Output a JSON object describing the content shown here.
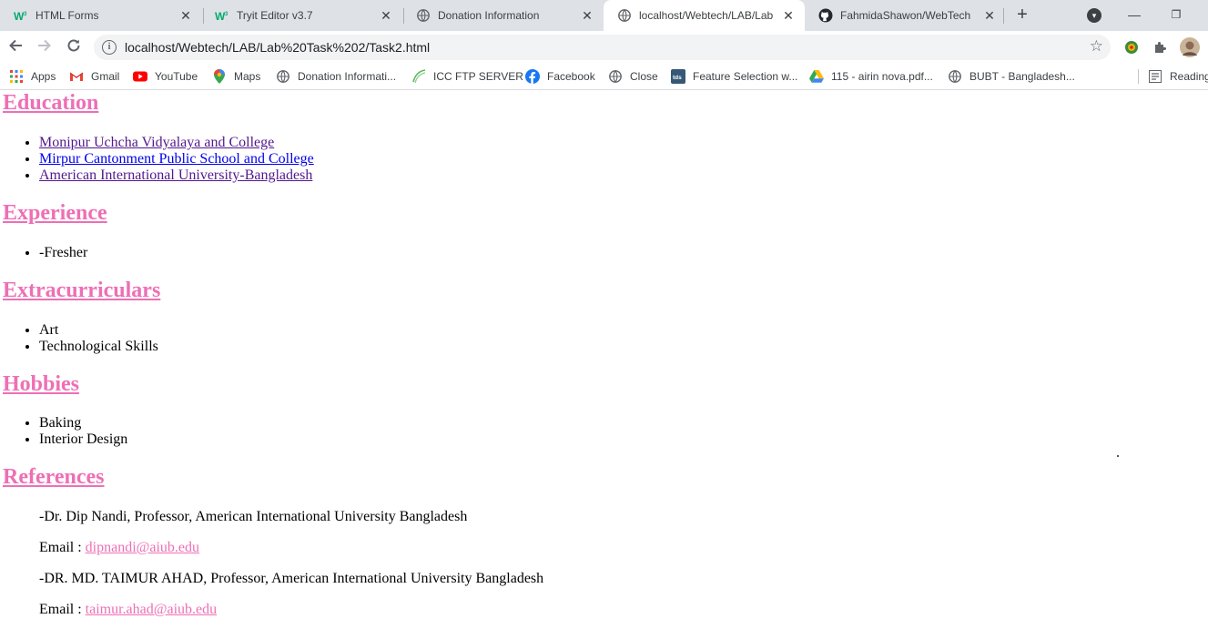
{
  "tabs": [
    {
      "title": "HTML Forms",
      "icon": "w3schools-icon",
      "active": false
    },
    {
      "title": "Tryit Editor v3.7",
      "icon": "w3schools-icon",
      "active": false
    },
    {
      "title": "Donation Information",
      "icon": "globe-icon",
      "active": false
    },
    {
      "title": "localhost/Webtech/LAB/Lab",
      "icon": "globe-icon",
      "active": true
    },
    {
      "title": "FahmidaShawon/WebTech",
      "icon": "github-icon",
      "active": false
    }
  ],
  "address_bar": {
    "url": "localhost/Webtech/LAB/Lab%20Task%202/Task2.html"
  },
  "bookmarks": [
    {
      "label": "Apps",
      "icon": "apps-grid-icon"
    },
    {
      "label": "Gmail",
      "icon": "gmail-icon"
    },
    {
      "label": "YouTube",
      "icon": "youtube-icon"
    },
    {
      "label": "Maps",
      "icon": "maps-pin-icon"
    },
    {
      "label": "Donation Informati...",
      "icon": "globe-icon"
    },
    {
      "label": "ICC FTP SERVER",
      "icon": "icc-icon"
    },
    {
      "label": "Facebook",
      "icon": "facebook-icon"
    },
    {
      "label": "Close",
      "icon": "globe-icon"
    },
    {
      "label": "Feature Selection w...",
      "icon": "tds-icon"
    },
    {
      "label": "115 - airin nova.pdf...",
      "icon": "google-drive-icon"
    },
    {
      "label": "BUBT - Bangladesh...",
      "icon": "globe-icon"
    }
  ],
  "reading_list": "Reading",
  "colors": {
    "heading": "#ee6fb5",
    "visited_link": "#52188c",
    "link": "#0000ee"
  },
  "page": {
    "education": {
      "heading": "Education",
      "items": [
        "Monipur Uchcha Vidyalaya and College",
        "Mirpur Cantonment Public School and College",
        "American International University-Bangladesh"
      ]
    },
    "experience": {
      "heading": "Experience",
      "items": [
        "-Fresher"
      ]
    },
    "extracurriculars": {
      "heading": "Extracurriculars",
      "items": [
        "Art",
        "Technological Skills"
      ]
    },
    "hobbies": {
      "heading": "Hobbies",
      "items": [
        "Baking",
        "Interior Design"
      ]
    },
    "references": {
      "heading": "References",
      "ref1_name": "-Dr. Dip Nandi, Professor, American International University Bangladesh",
      "ref1_email_label": "Email : ",
      "ref1_email": "dipnandi@aiub.edu",
      "ref2_name": "-DR. MD. TAIMUR AHAD, Professor, American International University Bangladesh",
      "ref2_email_label": "Email : ",
      "ref2_email": "taimur.ahad@aiub.edu"
    }
  }
}
